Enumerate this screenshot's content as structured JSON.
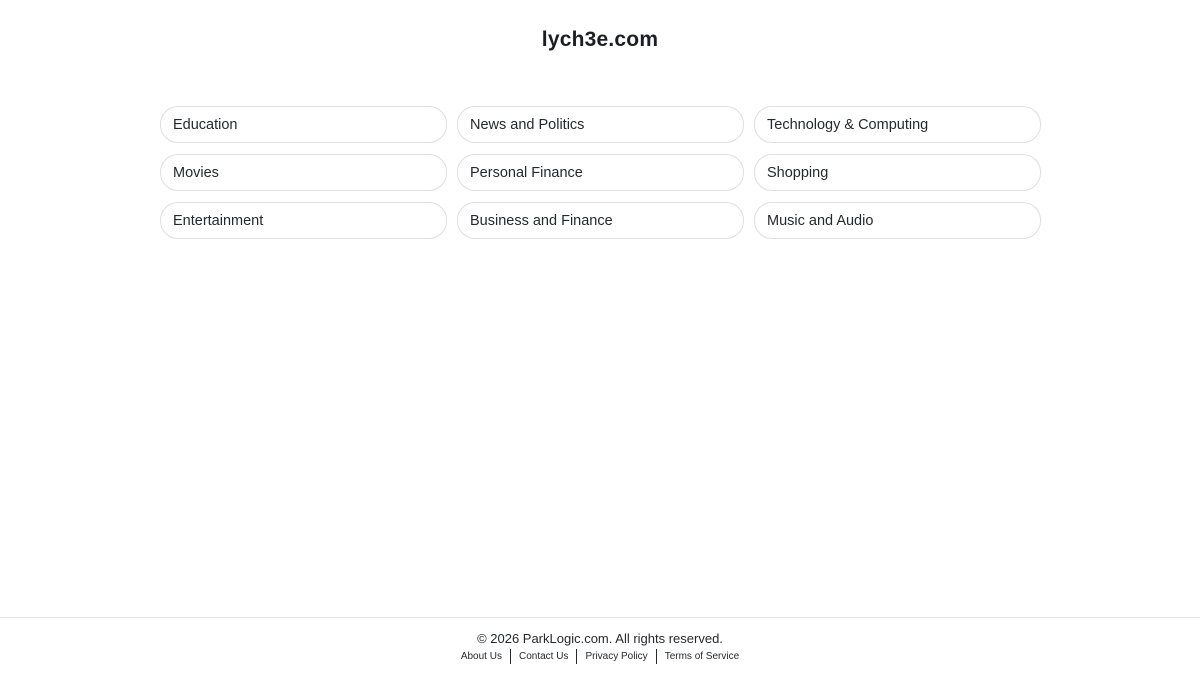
{
  "site": {
    "title": "lych3e.com"
  },
  "categories": [
    {
      "label": "Education"
    },
    {
      "label": "News and Politics"
    },
    {
      "label": "Technology & Computing"
    },
    {
      "label": "Movies"
    },
    {
      "label": "Personal Finance"
    },
    {
      "label": "Shopping"
    },
    {
      "label": "Entertainment"
    },
    {
      "label": "Business and Finance"
    },
    {
      "label": "Music and Audio"
    }
  ],
  "footer": {
    "copyright": "© 2026 ParkLogic.com. All rights reserved.",
    "links": [
      {
        "label": "About Us"
      },
      {
        "label": "Contact Us"
      },
      {
        "label": "Privacy Policy"
      },
      {
        "label": "Terms of Service"
      }
    ]
  }
}
